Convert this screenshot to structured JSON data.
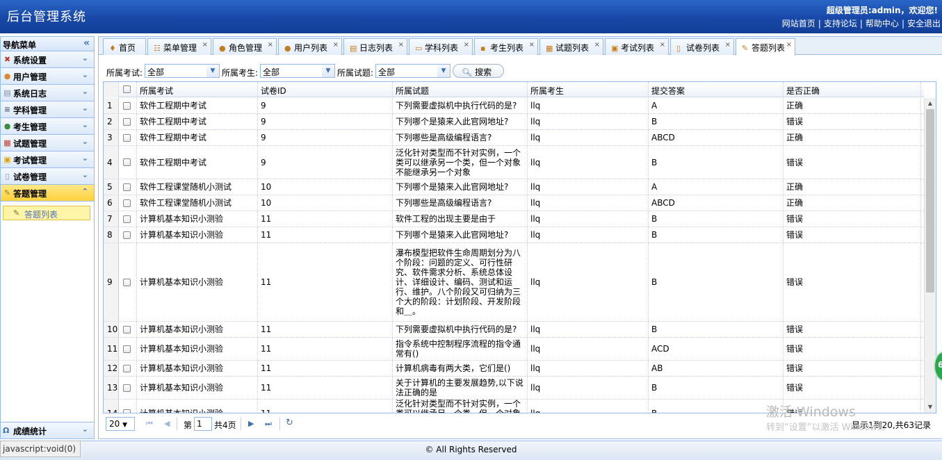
{
  "header": {
    "title": "后台管理系统",
    "welcome": "超级管理员:admin，欢迎您!",
    "links": [
      "网站首页",
      "支持论坛",
      "帮助中心",
      "安全退出"
    ],
    "sep": "|"
  },
  "sidebar": {
    "title": "导航菜单",
    "collapse": "«",
    "items": [
      {
        "label": "系统设置",
        "icon": "wrench-icon",
        "glyph": "✖",
        "color": "#c0392b"
      },
      {
        "label": "用户管理",
        "icon": "users-icon",
        "glyph": "●",
        "color": "#d98a2e"
      },
      {
        "label": "系统日志",
        "icon": "log-icon",
        "glyph": "▤",
        "color": "#7a8aa8"
      },
      {
        "label": "学科管理",
        "icon": "subject-icon",
        "glyph": "≡",
        "color": "#5a6a8a"
      },
      {
        "label": "考生管理",
        "icon": "students-icon",
        "glyph": "●",
        "color": "#3b8e3b"
      },
      {
        "label": "试题管理",
        "icon": "calendar-icon",
        "glyph": "▦",
        "color": "#c0392b"
      },
      {
        "label": "考试管理",
        "icon": "exam-icon",
        "glyph": "▣",
        "color": "#d9a21c"
      },
      {
        "label": "试卷管理",
        "icon": "paper-icon",
        "glyph": "▯",
        "color": "#7a8aa8"
      },
      {
        "label": "答题管理",
        "icon": "answer-icon",
        "glyph": "✎",
        "color": "#9a7b2a"
      }
    ],
    "expand": "⌄",
    "collapse_up": "⌃",
    "sub_item": "答题列表",
    "bottom": "成绩统计"
  },
  "tabs": [
    {
      "label": "首页",
      "icon": "home-icon",
      "glyph": "♦",
      "closable": false
    },
    {
      "label": "菜单管理",
      "icon": "menu-icon",
      "glyph": "☷",
      "closable": true
    },
    {
      "label": "角色管理",
      "icon": "role-icon",
      "glyph": "●",
      "closable": true
    },
    {
      "label": "用户列表",
      "icon": "user-icon",
      "glyph": "●",
      "closable": true
    },
    {
      "label": "日志列表",
      "icon": "log-icon",
      "glyph": "▤",
      "closable": true
    },
    {
      "label": "学科列表",
      "icon": "subject-icon",
      "glyph": "▭",
      "closable": true
    },
    {
      "label": "考生列表",
      "icon": "student-icon",
      "glyph": "▪",
      "closable": true
    },
    {
      "label": "试题列表",
      "icon": "calendar-icon",
      "glyph": "▦",
      "closable": true
    },
    {
      "label": "考试列表",
      "icon": "exam-icon",
      "glyph": "▣",
      "closable": true
    },
    {
      "label": "试卷列表",
      "icon": "paper-icon",
      "glyph": "▯",
      "closable": true
    },
    {
      "label": "答题列表",
      "icon": "answer-icon",
      "glyph": "✎",
      "closable": true
    }
  ],
  "close_glyph": "×",
  "filters": [
    {
      "label": "所属考试:",
      "value": "全部"
    },
    {
      "label": "所属考生:",
      "value": "全部"
    },
    {
      "label": "所属试题:",
      "value": "全部"
    }
  ],
  "search_label": "搜索",
  "columns": [
    "所属考试",
    "试卷ID",
    "所属试题",
    "所属考生",
    "提交答案",
    "是否正确"
  ],
  "rows": [
    {
      "n": "1",
      "exam": "软件工程期中考试",
      "pid": "9",
      "q": "下列需要虚拟机中执行代码的是?",
      "s": "llq",
      "a": "A",
      "r": "正确"
    },
    {
      "n": "2",
      "exam": "软件工程期中考试",
      "pid": "9",
      "q": "下列哪个是猿来入此官网地址?",
      "s": "llq",
      "a": "B",
      "r": "错误"
    },
    {
      "n": "3",
      "exam": "软件工程期中考试",
      "pid": "9",
      "q": "下列哪些是高级编程语言?",
      "s": "llq",
      "a": "ABCD",
      "r": "正确"
    },
    {
      "n": "4",
      "exam": "软件工程期中考试",
      "pid": "9",
      "q": "泛化针对类型而不针对实例，一个类可以继承另一个类，但一个对象不能继承另一个对象",
      "s": "llq",
      "a": "B",
      "r": "错误"
    },
    {
      "n": "5",
      "exam": "软件工程课堂随机小测试",
      "pid": "10",
      "q": "下列哪个是猿来入此官网地址?",
      "s": "llq",
      "a": "A",
      "r": "正确"
    },
    {
      "n": "6",
      "exam": "软件工程课堂随机小测试",
      "pid": "10",
      "q": "下列哪些是高级编程语言?",
      "s": "llq",
      "a": "ABCD",
      "r": "正确"
    },
    {
      "n": "7",
      "exam": "计算机基本知识小测验",
      "pid": "11",
      "q": "软件工程的出现主要是由于",
      "s": "llq",
      "a": "B",
      "r": "错误"
    },
    {
      "n": "8",
      "exam": "计算机基本知识小测验",
      "pid": "11",
      "q": "下列哪个是猿来入此官网地址?",
      "s": "llq",
      "a": "B",
      "r": "错误"
    },
    {
      "n": "9",
      "exam": "计算机基本知识小测验",
      "pid": "11",
      "q": "瀑布模型把软件生命周期划分为八个阶段：问题的定义、可行性研究、软件需求分析、系统总体设计、详细设计、编码、测试和运行、维护。八个阶段又可归纳为三个大的阶段：计划阶段、开发阶段和＿。",
      "s": "llq",
      "a": "B",
      "r": "错误"
    },
    {
      "n": "10",
      "exam": "计算机基本知识小测验",
      "pid": "11",
      "q": "下列需要虚拟机中执行代码的是?",
      "s": "llq",
      "a": "B",
      "r": "错误"
    },
    {
      "n": "11",
      "exam": "计算机基本知识小测验",
      "pid": "11",
      "q": "指令系统中控制程序流程的指令通常有()",
      "s": "llq",
      "a": "ACD",
      "r": "错误"
    },
    {
      "n": "12",
      "exam": "计算机基本知识小测验",
      "pid": "11",
      "q": "计算机病毒有两大类，它们是()",
      "s": "llq",
      "a": "AB",
      "r": "错误"
    },
    {
      "n": "13",
      "exam": "计算机基本知识小测验",
      "pid": "11",
      "q": "关于计算机的主要发展趋势,以下说法正确的是",
      "s": "llq",
      "a": "B",
      "r": "错误"
    },
    {
      "n": "14",
      "exam": "计算机基本知识小测验",
      "pid": "11",
      "q": "泛化针对类型而不针对实例，一个类可以继承另一个类，但一个对象不能继承另一个对象",
      "s": "llq",
      "a": "B",
      "r": "错误"
    }
  ],
  "pager": {
    "page_size": "20",
    "page_prefix": "第",
    "page_value": "1",
    "page_total": "共4页",
    "info": "显示1到20,共63记录",
    "first": "⏮",
    "prev": "◀",
    "next": "▶",
    "last": "⏭",
    "refresh": "↻"
  },
  "watermark": {
    "line1": "激活 Windows",
    "line2": "转到“设置”以激活 Windows。"
  },
  "badge": "6",
  "footer": "© All Rights Reserved",
  "statusbar": "javascript:void(0)"
}
